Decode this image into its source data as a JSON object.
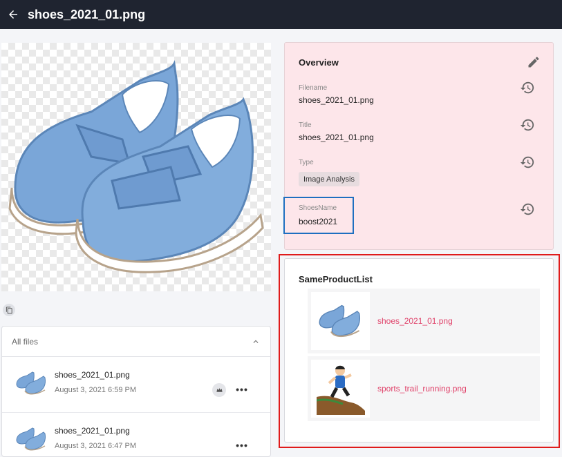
{
  "header": {
    "title": "shoes_2021_01.png",
    "back_icon": "arrow-left-icon"
  },
  "file_list": {
    "title": "All files",
    "items": [
      {
        "name": "shoes_2021_01.png",
        "date": "August 3, 2021 6:59 PM",
        "has_crown": true
      },
      {
        "name": "shoes_2021_01.png",
        "date": "August 3, 2021 6:47 PM",
        "has_crown": false
      }
    ]
  },
  "overview": {
    "title": "Overview",
    "fields": {
      "filename": {
        "label": "Filename",
        "value": "shoes_2021_01.png"
      },
      "title": {
        "label": "Title",
        "value": "shoes_2021_01.png"
      },
      "type": {
        "label": "Type",
        "value": "Image Analysis"
      },
      "shoes_name": {
        "label": "ShoesName",
        "value": "boost2021"
      }
    }
  },
  "same_product_list": {
    "title": "SameProductList",
    "items": [
      {
        "name": "shoes_2021_01.png"
      },
      {
        "name": "sports_trail_running.png"
      }
    ]
  },
  "colors": {
    "header_bg": "#1f2430",
    "overview_bg": "#fde6ea",
    "link": "#e0426a",
    "highlight_blue": "#1e6fc0",
    "highlight_red": "#e01b1b"
  }
}
